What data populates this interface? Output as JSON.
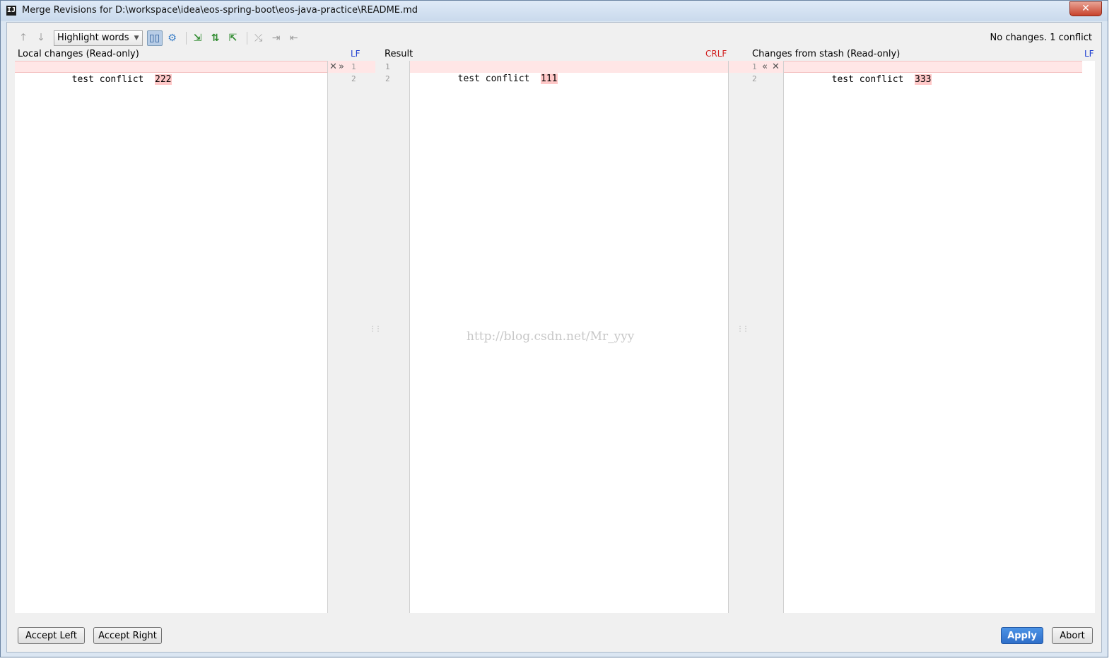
{
  "window": {
    "title": "Merge Revisions for D:\\workspace\\idea\\eos-spring-boot\\eos-java-practice\\README.md",
    "close_glyph": "✕"
  },
  "toolbar": {
    "highlight_mode": "Highlight words",
    "status": "No changes. 1 conflict"
  },
  "panels": {
    "left": {
      "title": "Local changes (Read-only)",
      "line_separator": "LF",
      "lines": [
        {
          "num": "1",
          "prefix": "test conflict  ",
          "highlight": "222"
        },
        {
          "num": "2"
        }
      ]
    },
    "center": {
      "title": "Result",
      "line_separator": "CRLF",
      "lines": [
        {
          "num": "1",
          "prefix": "test conflict  ",
          "highlight": "111"
        },
        {
          "num": "2"
        }
      ]
    },
    "right": {
      "title": "Changes from stash (Read-only)",
      "line_separator": "LF",
      "lines": [
        {
          "num": "1",
          "prefix": "test conflict  ",
          "highlight": "333"
        },
        {
          "num": "2"
        }
      ]
    }
  },
  "markers": {
    "left_ignore": "✕",
    "left_accept": "»",
    "right_accept": "«",
    "right_ignore": "✕"
  },
  "watermark": "http://blog.csdn.net/Mr_yyy",
  "buttons": {
    "accept_left": "Accept Left",
    "accept_right": "Accept Right",
    "apply": "Apply",
    "abort": "Abort"
  },
  "colors": {
    "conflict_bg": "#ffe6e6",
    "word_highlight": "#ffc8c8",
    "lf": "#1f3fd1",
    "crlf": "#d11f1f",
    "apply_button": "#3a7fd8"
  }
}
